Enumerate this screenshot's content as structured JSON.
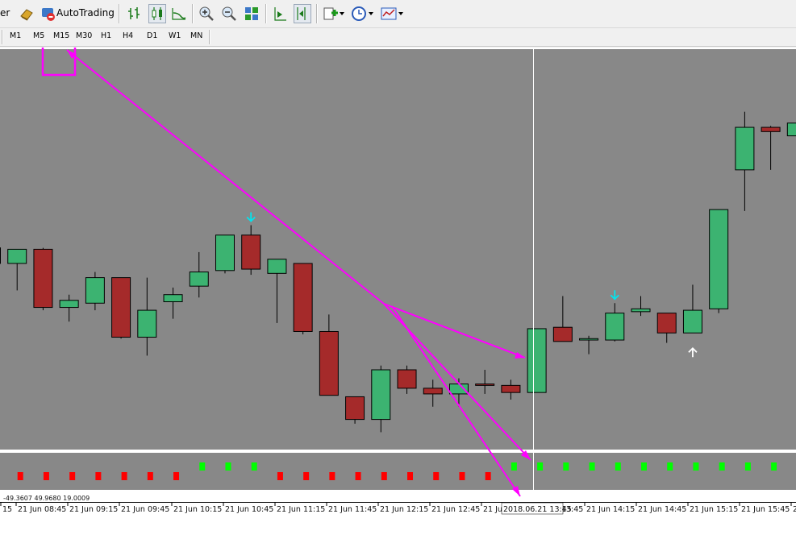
{
  "toolbar": {
    "left_fragment": "er",
    "autotrading_label": "AutoTrading"
  },
  "timeframes": [
    "M1",
    "M5",
    "M15",
    "M30",
    "H1",
    "H4",
    "D1",
    "W1",
    "MN"
  ],
  "indicator_readout": "-49.3607 49.9680 19.0009",
  "crosshair_label": "2018.06.21 13:45",
  "time_labels": [
    "15",
    "21 Jun 08:45",
    "21 Jun 09:15",
    "21 Jun 09:45",
    "21 Jun 10:15",
    "21 Jun 10:45",
    "21 Jun 11:15",
    "21 Jun 11:45",
    "21 Jun 12:15",
    "21 Jun 12:45",
    "21 Jun 13:15",
    "21 Jun 13:45",
    "21 Jun 14:15",
    "21 Jun 14:45",
    "21 Jun 15:15",
    "21 Jun 15:45",
    "21"
  ],
  "colors": {
    "chart_bg": "#888888",
    "bull": "#3cb371",
    "bear": "#a52a2a",
    "arrow_down": "#00e5ee",
    "arrow_up": "#ffffff",
    "annotation": "#ff00ff",
    "ind_red": "#ff0000",
    "ind_green": "#00ff00"
  },
  "candles": [
    {
      "t": 0,
      "o": 1.1,
      "h": 1.6,
      "l": -1.0,
      "c": 0.0
    },
    {
      "t": 1,
      "o": 0.0,
      "h": 0.4,
      "l": -1.9,
      "c": 1.0
    },
    {
      "t": 2,
      "o": 1.0,
      "h": 1.1,
      "l": -3.3,
      "c": -3.1
    },
    {
      "t": 3,
      "o": -3.1,
      "h": -2.2,
      "l": -4.1,
      "c": -2.6
    },
    {
      "t": 4,
      "o": -2.8,
      "h": -0.6,
      "l": -3.3,
      "c": -1.0
    },
    {
      "t": 5,
      "o": -1.0,
      "h": -1.0,
      "l": -5.3,
      "c": -5.2
    },
    {
      "t": 6,
      "o": -5.2,
      "h": -1.0,
      "l": -6.5,
      "c": -3.3
    },
    {
      "t": 7,
      "o": -2.7,
      "h": -1.7,
      "l": -3.9,
      "c": -2.2
    },
    {
      "t": 8,
      "o": -1.6,
      "h": 0.8,
      "l": -2.4,
      "c": -0.6
    },
    {
      "t": 9,
      "o": -0.5,
      "h": 0.9,
      "l": -0.7,
      "c": 2.0
    },
    {
      "t": 10,
      "o": 2.0,
      "h": 2.7,
      "l": -0.8,
      "c": -0.4
    },
    {
      "t": 11,
      "o": -0.7,
      "h": -0.2,
      "l": -4.2,
      "c": 0.3
    },
    {
      "t": 12,
      "o": 0.0,
      "h": 0.0,
      "l": -5.0,
      "c": -4.8
    },
    {
      "t": 13,
      "o": -4.8,
      "h": -3.6,
      "l": -6.4,
      "c": -9.3
    },
    {
      "t": 14,
      "o": -9.4,
      "h": -9.4,
      "l": -11.3,
      "c": -11.0
    },
    {
      "t": 15,
      "o": -11.0,
      "h": -7.2,
      "l": -11.9,
      "c": -7.5
    },
    {
      "t": 16,
      "o": -7.5,
      "h": -7.2,
      "l": -9.2,
      "c": -8.8
    },
    {
      "t": 17,
      "o": -8.8,
      "h": -8.2,
      "l": -10.1,
      "c": -9.2
    },
    {
      "t": 18,
      "o": -9.2,
      "h": -8.1,
      "l": -10.1,
      "c": -8.5
    },
    {
      "t": 19,
      "o": -8.5,
      "h": -7.5,
      "l": -9.2,
      "c": -8.6
    },
    {
      "t": 20,
      "o": -8.6,
      "h": -8.2,
      "l": -9.6,
      "c": -9.1
    },
    {
      "t": 21,
      "o": -9.1,
      "h": -4.6,
      "l": -9.1,
      "c": -4.6
    },
    {
      "t": 22,
      "o": -4.5,
      "h": -2.3,
      "l": -5.3,
      "c": -5.5
    },
    {
      "t": 23,
      "o": -5.4,
      "h": -5.1,
      "l": -6.4,
      "c": -5.3
    },
    {
      "t": 24,
      "o": -5.4,
      "h": -2.8,
      "l": -5.5,
      "c": -3.5
    },
    {
      "t": 25,
      "o": -3.4,
      "h": -2.3,
      "l": -3.7,
      "c": -3.2
    },
    {
      "t": 26,
      "o": -3.5,
      "h": -3.5,
      "l": -5.6,
      "c": -4.9
    },
    {
      "t": 27,
      "o": -4.9,
      "h": -1.5,
      "l": -4.9,
      "c": -3.3
    },
    {
      "t": 28,
      "o": -3.2,
      "h": 3.8,
      "l": -3.5,
      "c": 3.8
    },
    {
      "t": 29,
      "o": 6.6,
      "h": 10.7,
      "l": 3.7,
      "c": 9.6
    },
    {
      "t": 30,
      "o": 9.6,
      "h": 9.7,
      "l": 6.6,
      "c": 9.3
    },
    {
      "t": 31,
      "o": 9.0,
      "h": 10.6,
      "l": 8.0,
      "c": 9.9
    }
  ],
  "signal_arrows": [
    {
      "type": "down",
      "t": 10
    },
    {
      "type": "down",
      "t": 24
    },
    {
      "type": "up",
      "t": 27
    }
  ],
  "indicator_bars": [
    {
      "t": 0,
      "color": "red"
    },
    {
      "t": 1,
      "color": "red"
    },
    {
      "t": 2,
      "color": "red"
    },
    {
      "t": 3,
      "color": "red"
    },
    {
      "t": 4,
      "color": "red"
    },
    {
      "t": 5,
      "color": "red"
    },
    {
      "t": 6,
      "color": "red"
    },
    {
      "t": 7,
      "color": "red"
    },
    {
      "t": 8,
      "color": "green"
    },
    {
      "t": 9,
      "color": "green"
    },
    {
      "t": 10,
      "color": "green"
    },
    {
      "t": 11,
      "color": "red"
    },
    {
      "t": 12,
      "color": "red"
    },
    {
      "t": 13,
      "color": "red"
    },
    {
      "t": 14,
      "color": "red"
    },
    {
      "t": 15,
      "color": "red"
    },
    {
      "t": 16,
      "color": "red"
    },
    {
      "t": 17,
      "color": "red"
    },
    {
      "t": 18,
      "color": "red"
    },
    {
      "t": 19,
      "color": "red"
    },
    {
      "t": 20,
      "color": "green"
    },
    {
      "t": 21,
      "color": "green"
    },
    {
      "t": 22,
      "color": "green"
    },
    {
      "t": 23,
      "color": "green"
    },
    {
      "t": 24,
      "color": "green"
    },
    {
      "t": 25,
      "color": "green"
    },
    {
      "t": 26,
      "color": "green"
    },
    {
      "t": 27,
      "color": "green"
    },
    {
      "t": 28,
      "color": "green"
    },
    {
      "t": 29,
      "color": "green"
    },
    {
      "t": 30,
      "color": "green"
    }
  ]
}
